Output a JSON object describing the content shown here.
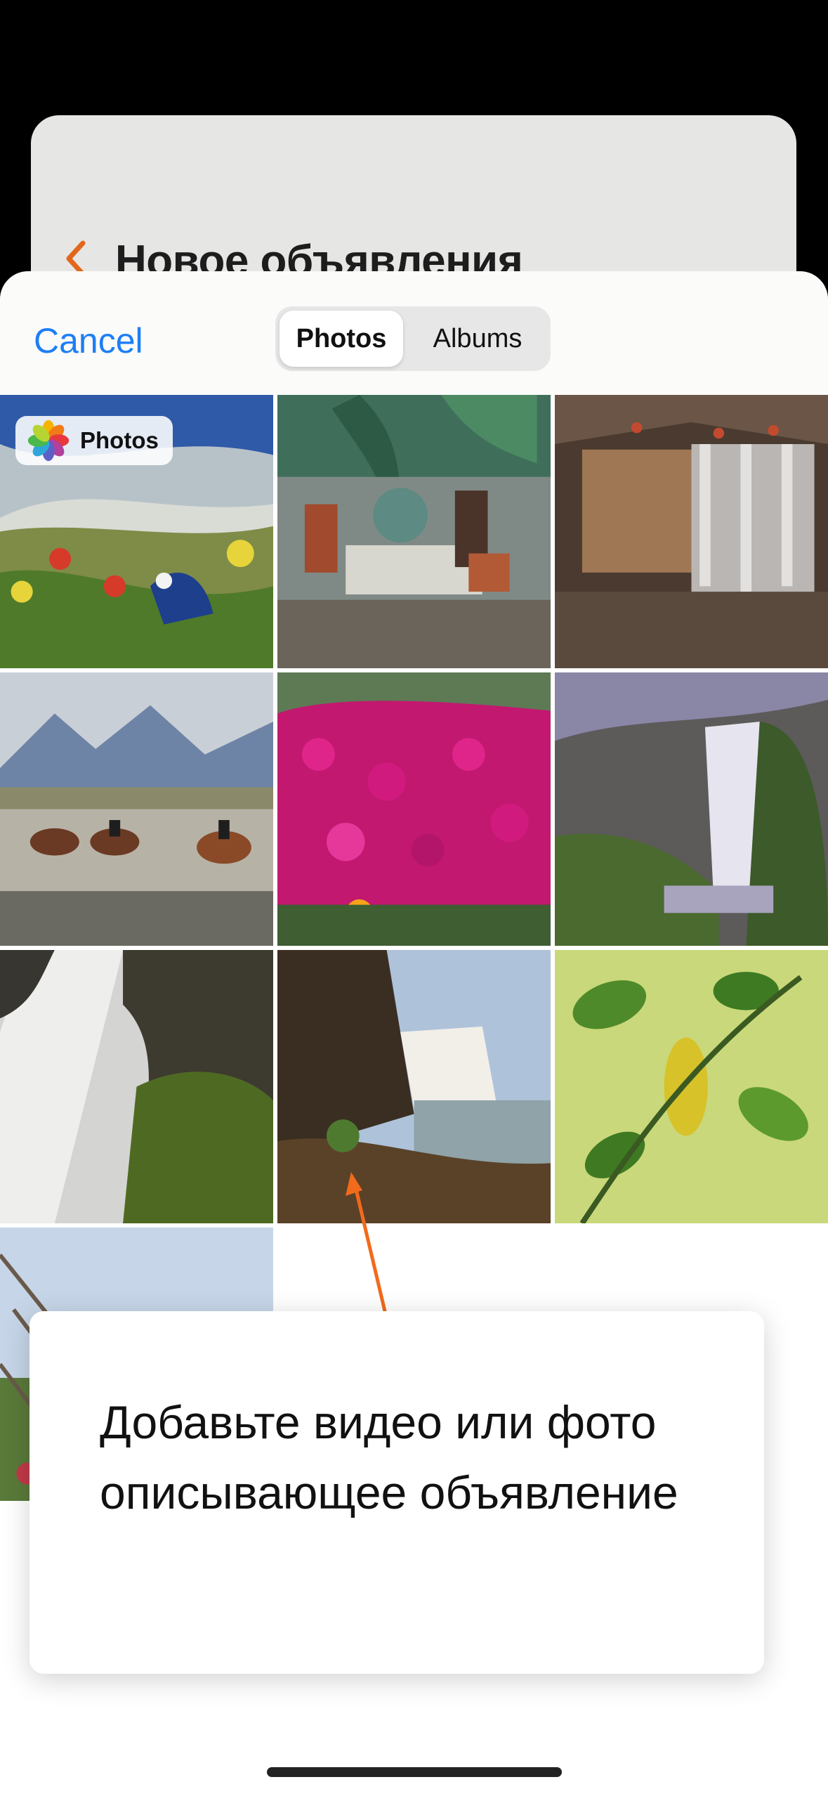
{
  "background_screen": {
    "title": "Новое объявления"
  },
  "picker": {
    "cancel_label": "Cancel",
    "segments": [
      {
        "label": "Photos",
        "selected": true
      },
      {
        "label": "Albums",
        "selected": false
      }
    ],
    "badge_label": "Photos",
    "tiles": [
      {
        "subject": "painting-field-flowers"
      },
      {
        "subject": "painting-people-table"
      },
      {
        "subject": "painting-yurt-interior"
      },
      {
        "subject": "painting-horse-riders"
      },
      {
        "subject": "photo-pink-flowers"
      },
      {
        "subject": "photo-waterfall-cliff"
      },
      {
        "subject": "photo-waterfall-moss"
      },
      {
        "subject": "photo-waterfall-sunset"
      },
      {
        "subject": "photo-green-leaves"
      },
      {
        "subject": "photo-grass-sky"
      }
    ]
  },
  "tooltip": {
    "text": "Добавьте видео или фото описывающее объявление"
  },
  "colors": {
    "accent_blue": "#1e7ef5",
    "arrow_orange": "#f26a1b"
  }
}
